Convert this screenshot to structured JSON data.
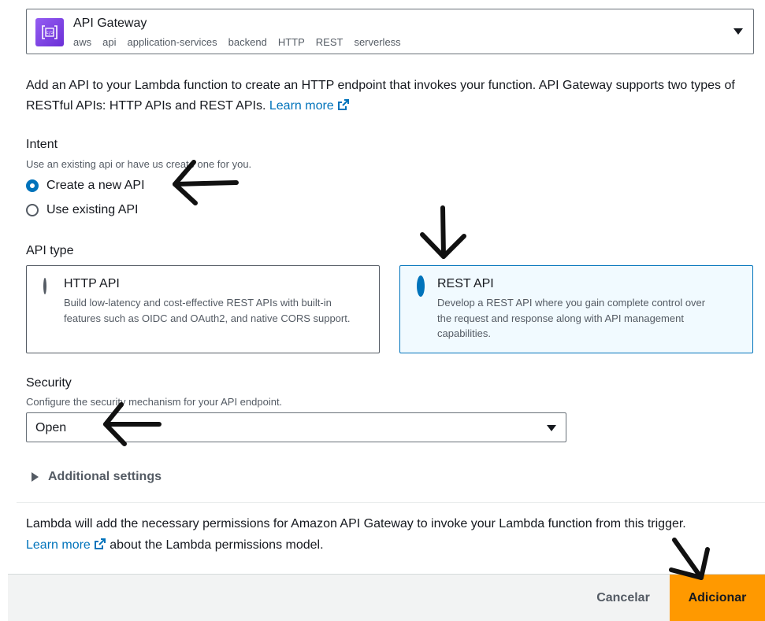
{
  "service": {
    "name": "API Gateway",
    "tags": [
      "aws",
      "api",
      "application-services",
      "backend",
      "HTTP",
      "REST",
      "serverless"
    ],
    "icon": "api-gateway-icon",
    "brand_color": "#7b3fe4"
  },
  "description": {
    "text": "Add an API to your Lambda function to create an HTTP endpoint that invokes your function. API Gateway supports two types of RESTful APIs: HTTP APIs and REST APIs.",
    "link": "Learn more"
  },
  "intent": {
    "label": "Intent",
    "hint": "Use an existing api or have us create one for you.",
    "options": [
      {
        "label": "Create a new API",
        "selected": true
      },
      {
        "label": "Use existing API",
        "selected": false
      }
    ]
  },
  "api_type": {
    "label": "API type",
    "options": [
      {
        "title": "HTTP API",
        "desc": "Build low-latency and cost-effective REST APIs with built-in features such as OIDC and OAuth2, and native CORS support.",
        "selected": false
      },
      {
        "title": "REST API",
        "desc": "Develop a REST API where you gain complete control over the request and response along with API management capabilities.",
        "selected": true
      }
    ]
  },
  "security": {
    "label": "Security",
    "hint": "Configure the security mechanism for your API endpoint.",
    "value": "Open"
  },
  "additional_settings": {
    "label": "Additional settings"
  },
  "permissions": {
    "text1": "Lambda will add the necessary permissions for Amazon API Gateway to invoke your Lambda function from this trigger.",
    "link": "Learn more",
    "text2": "about the Lambda permissions model."
  },
  "footer": {
    "cancel": "Cancelar",
    "add": "Adicionar"
  },
  "colors": {
    "accent": "#0073bb",
    "primary_button": "#ff9900",
    "selected_card_bg": "#f1faff"
  }
}
